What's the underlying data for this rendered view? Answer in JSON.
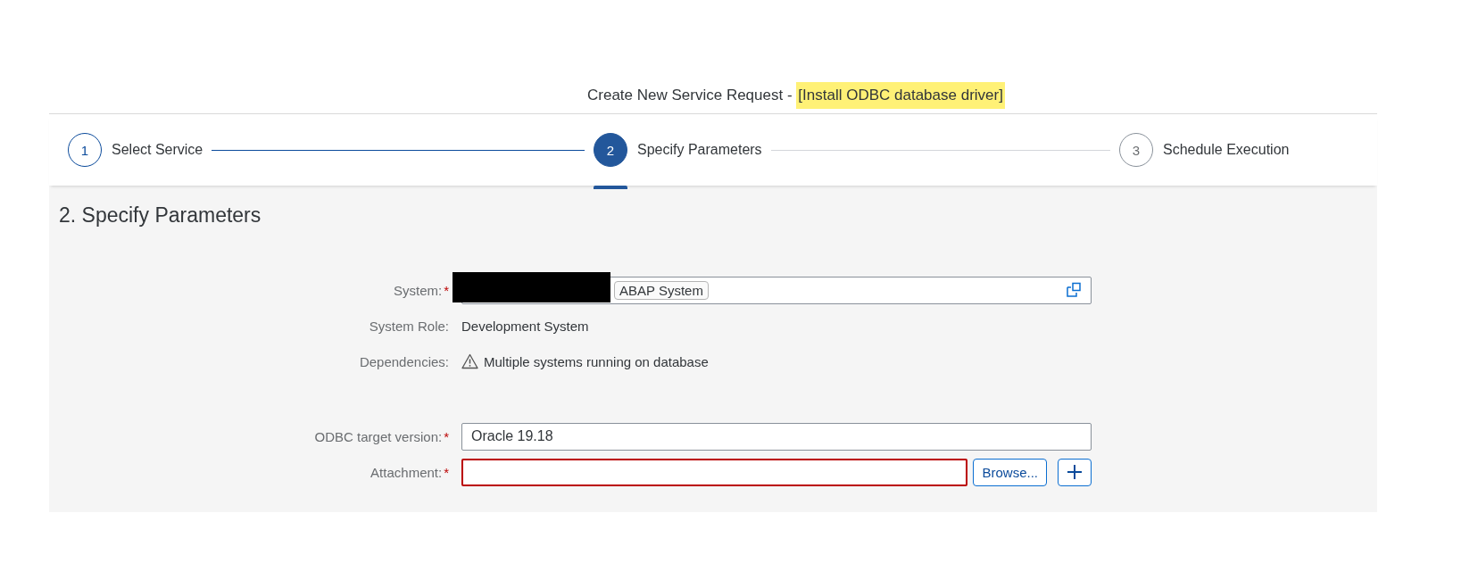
{
  "header": {
    "title": "Create New Service Request - ",
    "highlight": "[Install ODBC database driver]"
  },
  "steps": [
    {
      "number": "1",
      "label": "Select Service",
      "selected": false,
      "completed": true
    },
    {
      "number": "2",
      "label": "Specify Parameters",
      "selected": true,
      "completed": false
    },
    {
      "number": "3",
      "label": "Schedule Execution",
      "selected": false,
      "completed": false
    }
  ],
  "section_title": "2. Specify Parameters",
  "fields": [
    {
      "kind": "token",
      "label": "System:",
      "required_mark": "*",
      "token": "ABAP System"
    },
    {
      "kind": "text",
      "label": "System Role:",
      "value": "Development System"
    },
    {
      "kind": "warning",
      "label": "Dependencies:",
      "value": "Multiple systems running on database"
    },
    {
      "kind": "input",
      "label": "ODBC target version:",
      "required_mark": "*",
      "value": "Oracle 19.18"
    },
    {
      "kind": "file",
      "label": "Attachment:",
      "required_mark": "*",
      "error": true,
      "button": "Browse..."
    }
  ]
}
